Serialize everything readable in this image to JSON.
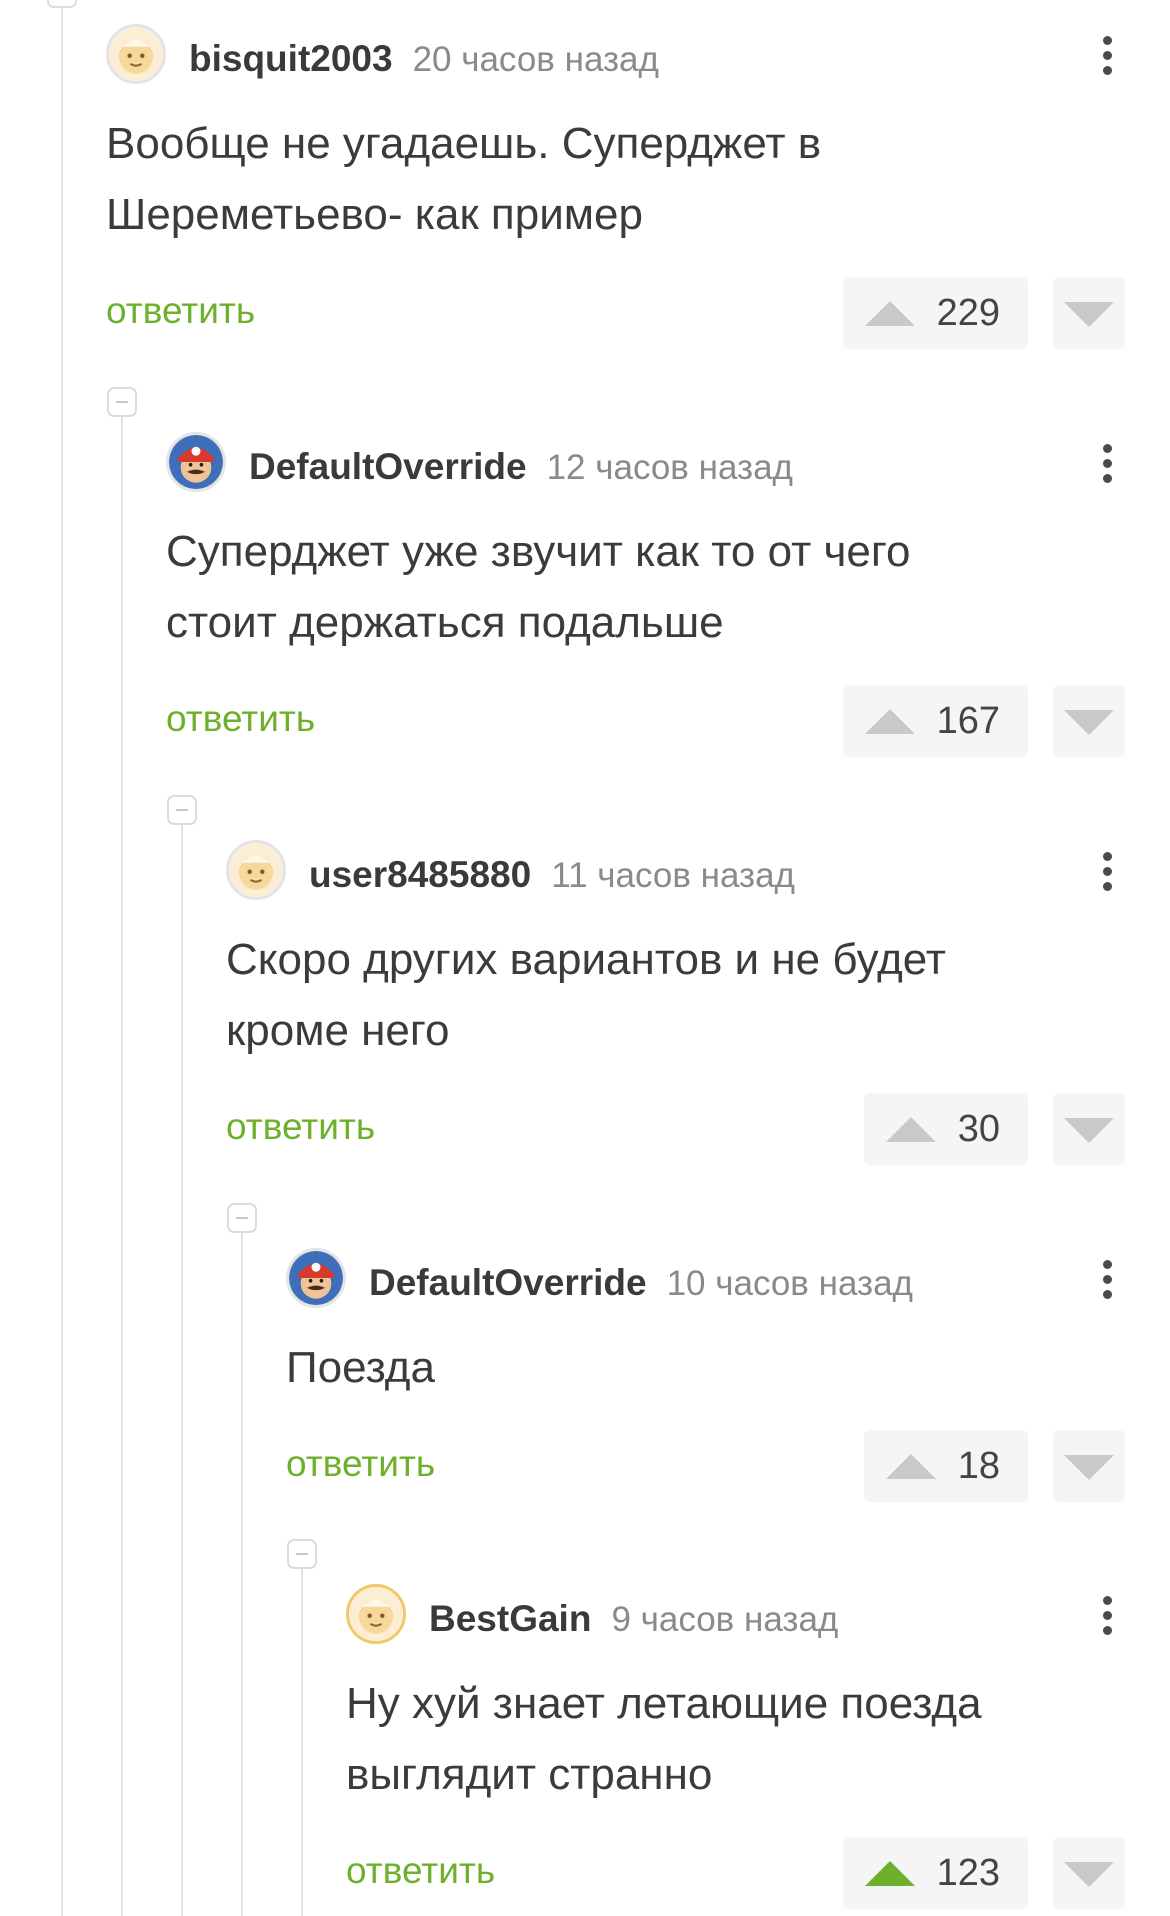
{
  "comments": [
    {
      "username": "bisquit2003",
      "time": "20 часов назад",
      "avatar_icon": "default-avatar-icon",
      "text": [
        "Вообще не угадаешь. Суперджет в",
        "Шереметьево- как пример"
      ],
      "reply_label": "ответить",
      "rating": "229",
      "upvoted": false
    },
    {
      "username": "DefaultOverride",
      "time": "12 часов назад",
      "avatar_icon": "mario-avatar-icon",
      "text": [
        "Суперджет уже звучит как то от чего",
        "стоит держаться подальше"
      ],
      "reply_label": "ответить",
      "rating": "167",
      "upvoted": false
    },
    {
      "username": "user8485880",
      "time": "11 часов назад",
      "avatar_icon": "default-avatar-icon",
      "text": [
        "Скоро других вариантов и не будет",
        "кроме него"
      ],
      "reply_label": "ответить",
      "rating": "30",
      "upvoted": false
    },
    {
      "username": "DefaultOverride",
      "time": "10 часов назад",
      "avatar_icon": "mario-avatar-icon",
      "text": [
        "Поезда"
      ],
      "reply_label": "ответить",
      "rating": "18",
      "upvoted": false
    },
    {
      "username": "BestGain",
      "time": "9 часов назад",
      "avatar_icon": "default-avatar-icon",
      "text": [
        "Ну хуй знает летающие поезда",
        "выглядит странно"
      ],
      "reply_label": "ответить",
      "rating": "123",
      "upvoted": true
    }
  ],
  "colors": {
    "accent_green": "#6eb02c",
    "vote_inactive": "#c9c9c9",
    "thread_line": "#e3e3e3"
  }
}
